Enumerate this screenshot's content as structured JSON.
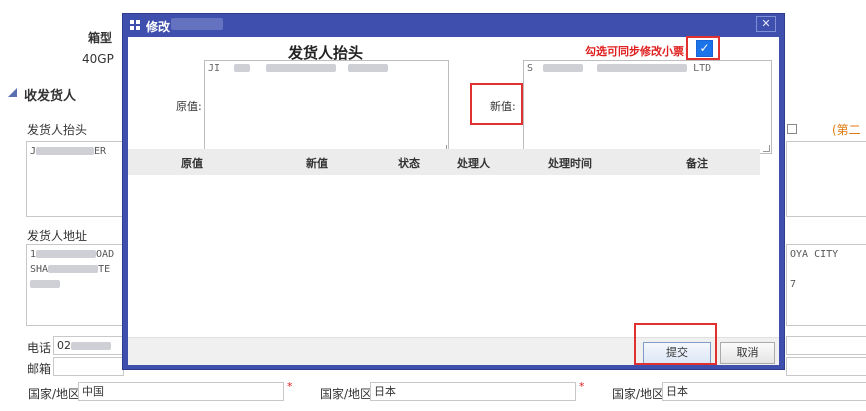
{
  "background": {
    "box_type_label": "箱型",
    "box_type_value": "40GP",
    "section_title": "收发货人",
    "shipper_header_label": "发货人抬头",
    "shipper_header_value": "J",
    "shipper_header_tail": "ER",
    "right_link": "(第二",
    "shipper_address_label": "发货人地址",
    "shipper_address_line1": "1",
    "shipper_address_line1_tail": "OAD",
    "shipper_address_line2": "SHA",
    "shipper_address_line2_tail": "TE",
    "right_address_line1": "OYA CITY",
    "right_address_line2": "7",
    "phone_label": "电话",
    "phone_value": "02",
    "postcode_label": "邮箱",
    "country_label_1": "国家/地区",
    "country_value_1": "中国",
    "country_label_2": "国家/地区",
    "country_value_2": "日本",
    "country_label_3": "国家/地区",
    "country_value_3": "日本",
    "required_mark": "*"
  },
  "dialog": {
    "title": "修改",
    "close_label": "✕",
    "heading": "发货人抬头",
    "sync_label": "勾选可同步修改小票：",
    "sync_checked_glyph": "✓",
    "old_value_label": "原值:",
    "new_value_label": "新值:",
    "old_value_text": "JI",
    "new_value_text": "S",
    "new_value_tail": "LTD",
    "columns": [
      "原值",
      "新值",
      "状态",
      "处理人",
      "处理时间",
      "备注"
    ],
    "submit_label": "提交",
    "cancel_label": "取消"
  },
  "colors": {
    "dialog_frame": "#3f4fad",
    "highlight_red": "#e03030",
    "sync_label_red": "#e02020",
    "checkbox_blue": "#1a73e8"
  }
}
